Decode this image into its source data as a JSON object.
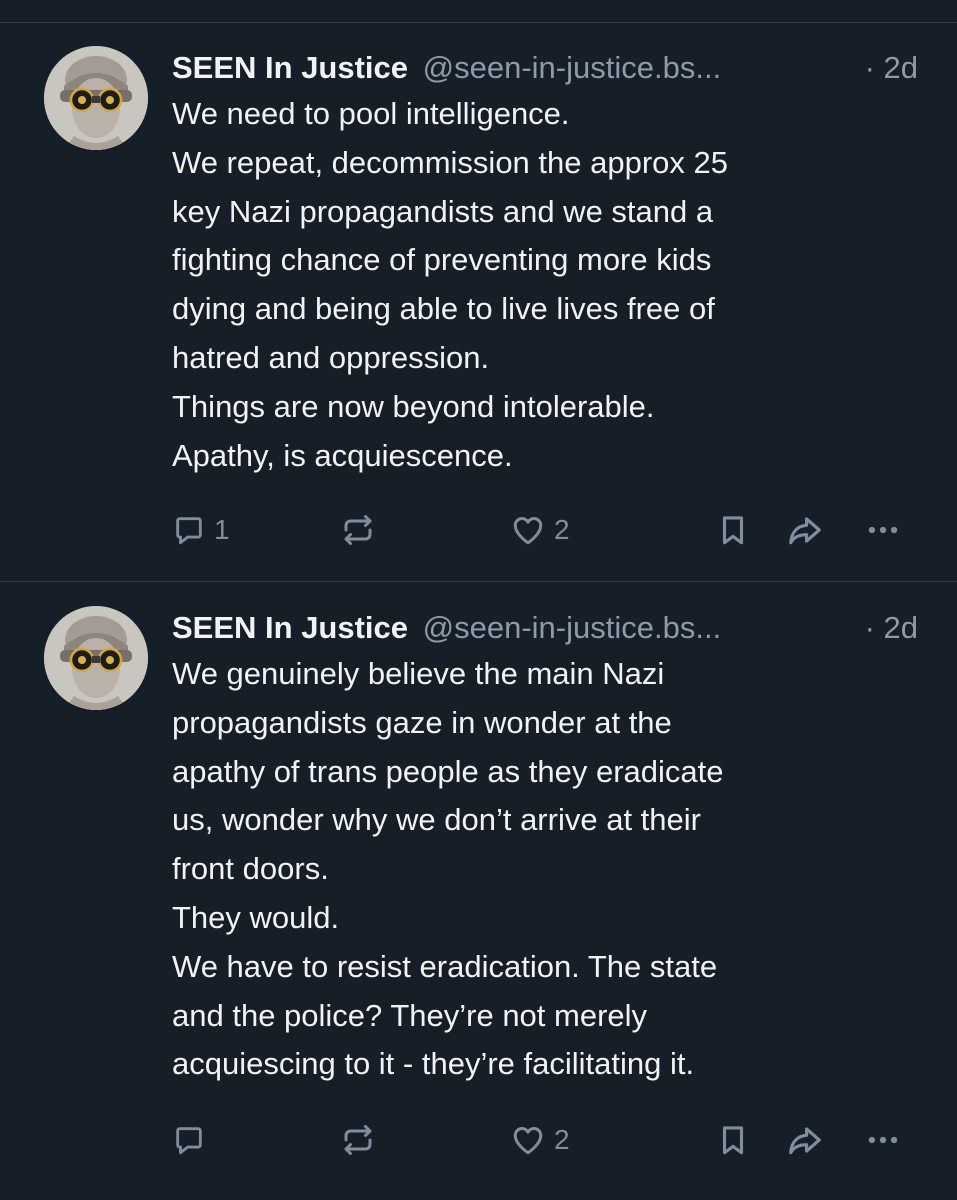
{
  "posts": [
    {
      "author": {
        "display_name": "SEEN In Justice",
        "handle": "@seen-in-justice.bs...",
        "avatar_icon": "blindfolded-statue-binoculars-avatar"
      },
      "time": "· 2d",
      "lines": [
        "We need to pool intelligence.",
        "We repeat, decommission the approx 25",
        "key Nazi propagandists and we stand a",
        "fighting chance of preventing more kids",
        "dying and being able to live lives free of",
        "hatred and oppression.",
        "Things are now beyond intolerable.",
        "Apathy, is acquiescence."
      ],
      "actions": {
        "reply_count": "1",
        "repost_count": "",
        "like_count": "2"
      }
    },
    {
      "author": {
        "display_name": "SEEN In Justice",
        "handle": "@seen-in-justice.bs...",
        "avatar_icon": "blindfolded-statue-binoculars-avatar"
      },
      "time": "· 2d",
      "lines": [
        "We genuinely believe the main Nazi",
        "propagandists gaze in wonder at the",
        "apathy of trans people as they eradicate",
        "us, wonder why we don’t arrive at their",
        "front doors.",
        "They would.",
        "We have to resist eradication. The state",
        "and the police? They’re not merely",
        "acquiescing to it - they’re facilitating it."
      ],
      "actions": {
        "reply_count": "",
        "repost_count": "",
        "like_count": "2"
      }
    }
  ],
  "icons": {
    "reply": "reply-bubble-icon",
    "repost": "repost-arrows-icon",
    "like": "heart-icon",
    "bookmark": "bookmark-icon",
    "share": "share-arrow-icon",
    "more": "more-dots-icon"
  },
  "colors": {
    "background": "#161e27",
    "text": "#f1f3f5",
    "muted": "#8d9aaa",
    "icon": "#7f8d9f",
    "divider": "#2c3946"
  }
}
